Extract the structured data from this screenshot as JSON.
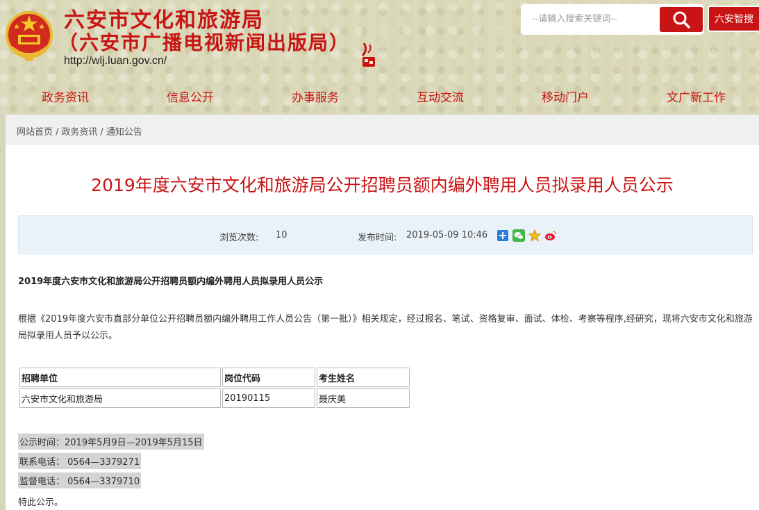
{
  "header": {
    "title": "六安市文化和旅游局",
    "subtitle": "（六安市广播电视新闻出版局）",
    "url": "http://wlj.luan.gov.cn/",
    "search_placeholder": "--请输入搜索关键词--",
    "zhisou_label": "六安智搜"
  },
  "nav": {
    "items": [
      "政务资讯",
      "信息公开",
      "办事服务",
      "互动交流",
      "移动门户",
      "文广新工作"
    ]
  },
  "breadcrumb": [
    "网站首页",
    "政务资讯",
    "通知公告"
  ],
  "article": {
    "title": "2019年度六安市文化和旅游局公开招聘员额内编外聘用人员拟录用人员公示",
    "views_label": "浏览次数:",
    "views_value": "10",
    "date_label": "发布时间:",
    "date_value": "2019-05-09 10:46",
    "heading": "2019年度六安市文化和旅游局公开招聘员额内编外聘用人员拟录用人员公示",
    "paragraph": "根据《2019年度六安市直部分单位公开招聘员额内编外聘用工作人员公告（第一批）》相关规定，经过报名、笔试、资格复审、面试、体检、考察等程序,经研究，现将六安市文化和旅游局拟录用人员予以公示。",
    "table": {
      "headers": [
        "招聘单位",
        "岗位代码",
        "考生姓名"
      ],
      "rows": [
        [
          "六安市文化和旅游局",
          "20190115",
          "聂庆美"
        ]
      ]
    },
    "notice_period": "公示时间：2019年5月9日—2019年5月15日",
    "contact_phone": "联系电话：  0564—3379271",
    "supervise_phone": "监督电话：  0564—3379710",
    "closing": "特此公示。"
  },
  "colors": {
    "brand_red": "#c81414",
    "header_bg": "#d9d7b6",
    "meta_bg": "#e9f2f8"
  },
  "icons": [
    "national-emblem-icon",
    "seal-icon",
    "search-icon",
    "plus-share-icon",
    "wechat-icon",
    "star-icon",
    "weibo-icon"
  ]
}
